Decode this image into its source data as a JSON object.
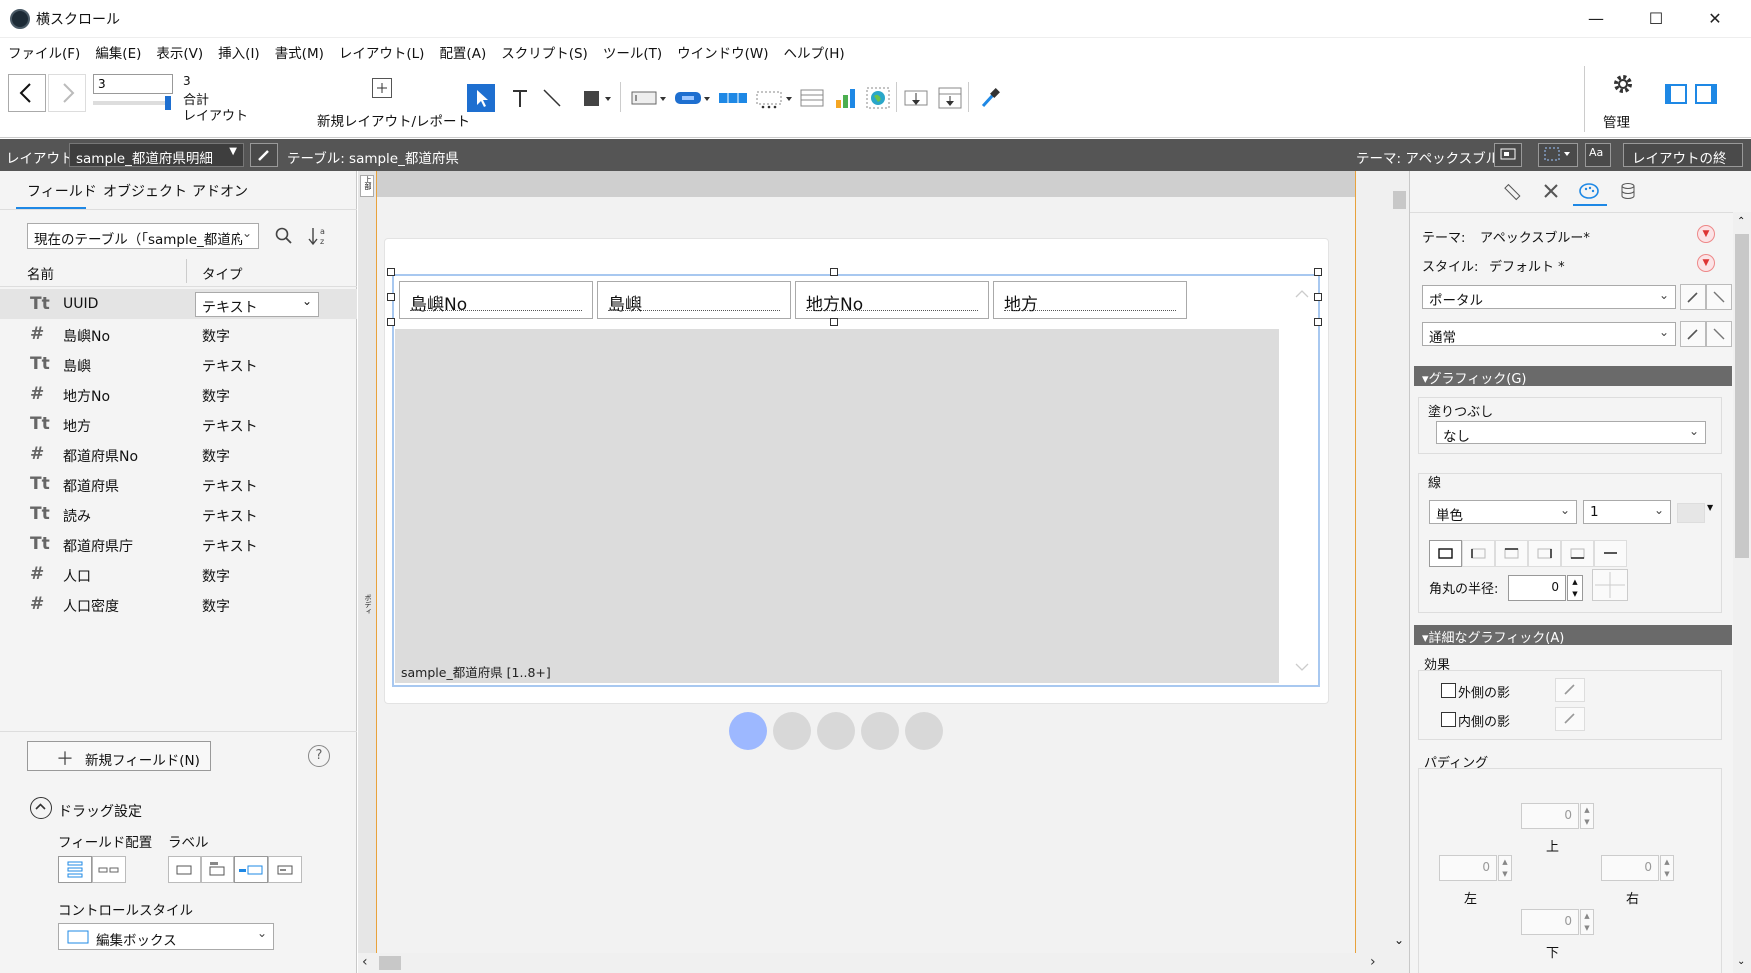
{
  "window": {
    "title": "横スクロール",
    "minimize": "—",
    "maximize": "☐",
    "close": "✕"
  },
  "menu": [
    "ファイル(F)",
    "編集(E)",
    "表示(V)",
    "挿入(I)",
    "書式(M)",
    "レイアウト(L)",
    "配置(A)",
    "スクリプト(S)",
    "ツール(T)",
    "ウインドウ(W)",
    "ヘルプ(H)"
  ],
  "toolbar": {
    "page_input": "3",
    "page_count": "3",
    "total_label": "合計",
    "layout_label": "レイアウト",
    "new_layout_label": "新規レイアウト/レポート",
    "manage_label": "管理"
  },
  "layoutbar": {
    "layout_label": "レイアウト:",
    "layout_name": "sample_都道府県明細",
    "table_label": "テーブル: sample_都道府県",
    "theme_label": "テーマ: アペックスブルー",
    "exit_button": "レイアウトの終了",
    "font_button": "Aa"
  },
  "left": {
    "tabs": [
      "フィールド",
      "オブジェクト",
      "アドオン"
    ],
    "table_select": "現在のテーブル（「sample_都道府",
    "col_name": "名前",
    "col_type": "タイプ",
    "fields": [
      {
        "icon": "Tt",
        "name": "UUID",
        "type": "テキスト"
      },
      {
        "icon": "#",
        "name": "島嶼No",
        "type": "数字"
      },
      {
        "icon": "Tt",
        "name": "島嶼",
        "type": "テキスト"
      },
      {
        "icon": "#",
        "name": "地方No",
        "type": "数字"
      },
      {
        "icon": "Tt",
        "name": "地方",
        "type": "テキスト"
      },
      {
        "icon": "#",
        "name": "都道府県No",
        "type": "数字"
      },
      {
        "icon": "Tt",
        "name": "都道府県",
        "type": "テキスト"
      },
      {
        "icon": "Tt",
        "name": "読み",
        "type": "テキスト"
      },
      {
        "icon": "Tt",
        "name": "都道府県庁",
        "type": "テキスト"
      },
      {
        "icon": "#",
        "name": "人口",
        "type": "数字"
      },
      {
        "icon": "#",
        "name": "人口密度",
        "type": "数字"
      }
    ],
    "new_field_button": "新規フィールド(N)",
    "new_field_plus": "＋",
    "help_icon": "?",
    "drag_settings": "ドラッグ設定",
    "field_placement": "フィールド配置",
    "label_label": "ラベル",
    "control_style": "コントロールスタイル",
    "control_value": "編集ボックス"
  },
  "canvas": {
    "portal_headers": [
      "島嶼No",
      "島嶼",
      "地方No",
      "地方"
    ],
    "portal_label": "sample_都道府県 [1..8+]",
    "part_header": "上部",
    "part_body": "ボディ",
    "dots_active": 0,
    "dots_count": 5
  },
  "right": {
    "theme_label": "テーマ:",
    "theme_value": "アペックスブルー*",
    "style_label": "スタイル:",
    "style_value": "デフォルト *",
    "object_select": "ポータル",
    "state_select": "通常",
    "graphic_section": "グラフィック(G)",
    "fill_label": "塗りつぶし",
    "fill_value": "なし",
    "line_label": "線",
    "line_type": "単色",
    "line_width": "1",
    "corner_label": "角丸の半径:",
    "corner_value": "0",
    "advanced_section": "詳細なグラフィック(A)",
    "effects_label": "効果",
    "outer_shadow": "外側の影",
    "inner_shadow": "内側の影",
    "padding_label": "パディング",
    "pad_top": "0",
    "pad_left": "0",
    "pad_right": "0",
    "pad_bottom": "0",
    "pad_top_label": "上",
    "pad_left_label": "左",
    "pad_right_label": "右",
    "pad_bottom_label": "下"
  },
  "colors": {
    "accent": "#1e88e5",
    "toolbar_dark": "#555555",
    "portal_border": "#6fa3e0",
    "dot_active": "#9db8ff",
    "dot_inactive": "#d8d8d8"
  }
}
